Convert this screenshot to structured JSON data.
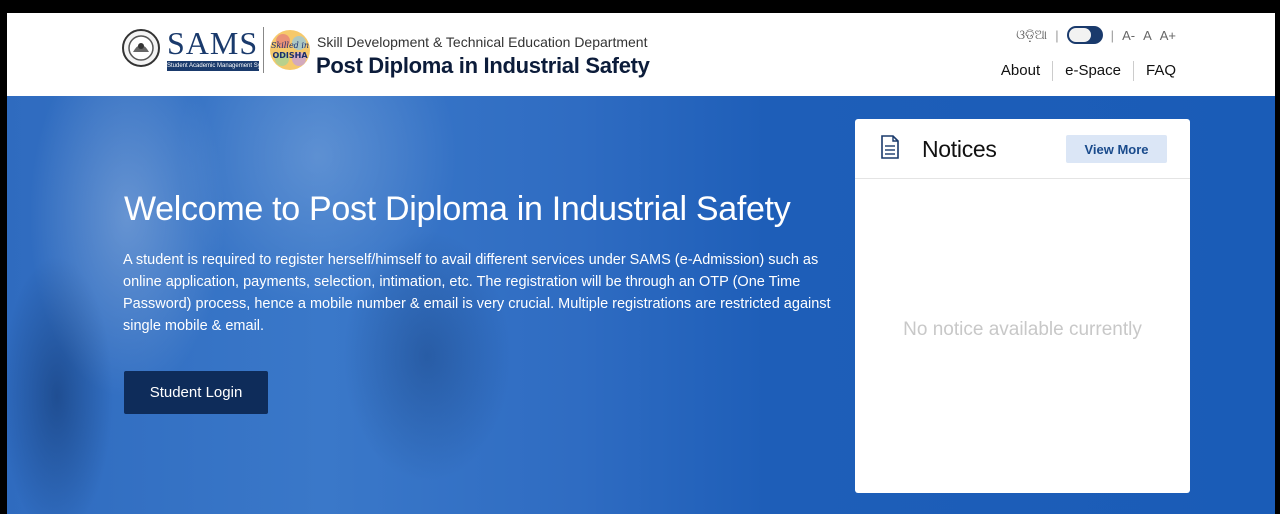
{
  "header": {
    "brand_word": "SAMS",
    "brand_sub": "Student Academic Management System",
    "skilled_logo_text": "Skilled in ODISHA",
    "department": "Skill Development & Technical Education Department",
    "course": "Post Diploma in Industrial Safety",
    "language_label": "ଓଡ଼ିଆ",
    "font_decrease": "A-",
    "font_normal": "A",
    "font_increase": "A+",
    "nav": [
      "About",
      "e-Space",
      "FAQ"
    ]
  },
  "hero": {
    "title": "Welcome to Post Diploma in Industrial Safety",
    "description": "A student is required to register herself/himself to avail different services under SAMS (e-Admission) such as online application, payments, selection, intimation, etc. The registration will be through an OTP (One Time Password) process, hence a mobile number & email is very crucial. Multiple registrations are restricted against single mobile & email.",
    "login_label": "Student Login"
  },
  "notices": {
    "title": "Notices",
    "view_more_label": "View More",
    "empty_text": "No notice available currently"
  },
  "colors": {
    "brand_navy": "#1a3a6c",
    "hero_blue": "#1e5eb8",
    "button_dark": "#0e2c5a",
    "view_more_bg": "#dbe6f6"
  },
  "icons": {
    "emblem": "odisha-emblem-icon",
    "skilled": "skilled-in-odisha-logo",
    "notices": "document-icon"
  }
}
